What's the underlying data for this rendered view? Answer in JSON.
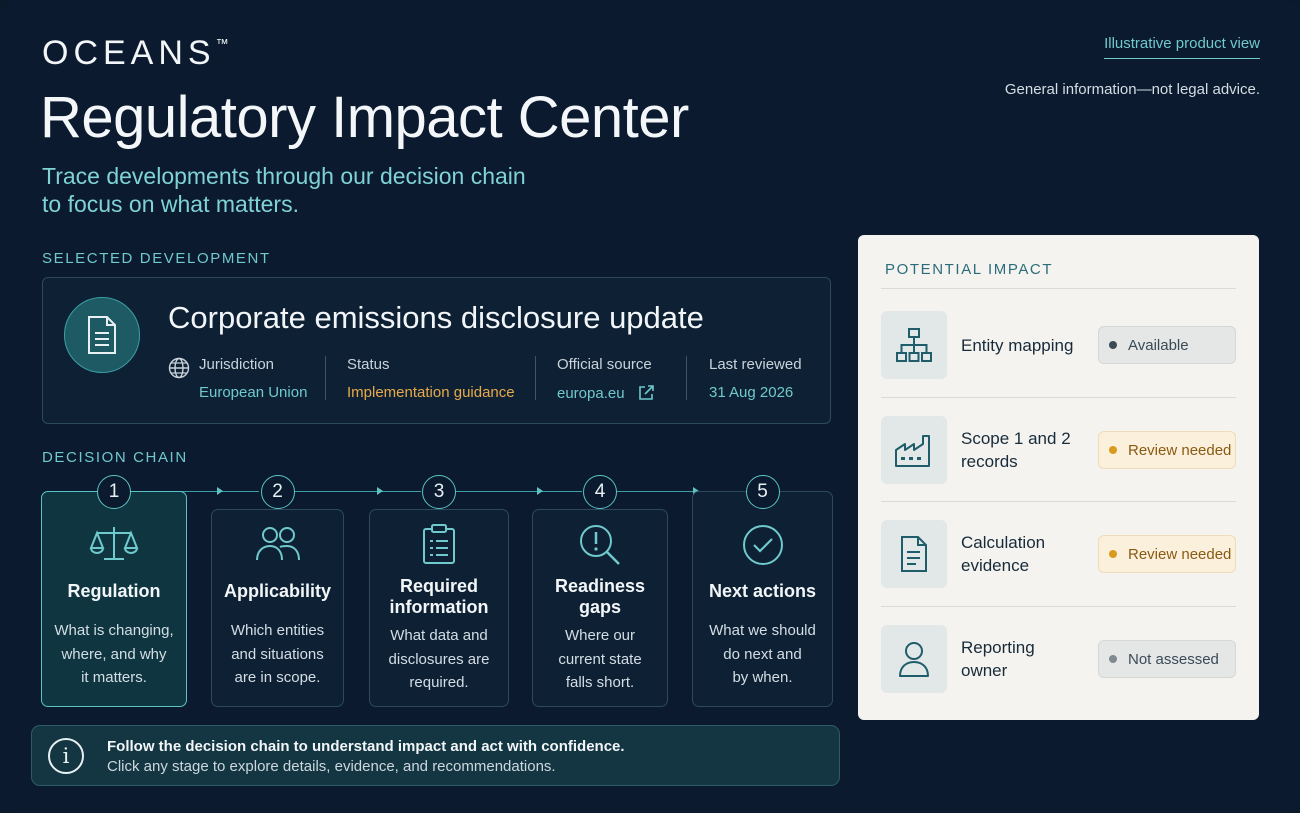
{
  "brand": {
    "name": "OCEANS",
    "mark": "™"
  },
  "header": {
    "title": "Regulatory Impact Center",
    "subtitle_line1": "Trace developments through our decision chain",
    "subtitle_line2": "to focus on what matters.",
    "illustrative_link": "Illustrative product view",
    "disclaimer": "General information—not legal advice."
  },
  "selected": {
    "section_label": "SELECTED DEVELOPMENT",
    "icon": "document-icon",
    "title": "Corporate emissions disclosure update",
    "jurisdiction_label": "Jurisdiction",
    "jurisdiction_value": "European Union",
    "status_label": "Status",
    "status_value": "Implementation guidance",
    "source_label": "Official source",
    "source_value": "europa.eu",
    "reviewed_label": "Last reviewed",
    "reviewed_value": "31 Aug 2026"
  },
  "chain": {
    "section_label": "DECISION CHAIN",
    "stages": [
      {
        "num": "1",
        "icon": "scales-icon",
        "title_line1": "Regulation",
        "title_line2": "",
        "desc_line1": "What is changing,",
        "desc_line2": "where, and why",
        "desc_line3": "it matters."
      },
      {
        "num": "2",
        "icon": "people-icon",
        "title_line1": "Applicability",
        "title_line2": "",
        "desc_line1": "Which entities",
        "desc_line2": "and situations",
        "desc_line3": "are in scope."
      },
      {
        "num": "3",
        "icon": "clipboard-icon",
        "title_line1": "Required",
        "title_line2": "information",
        "desc_line1": "What data and",
        "desc_line2": "disclosures are",
        "desc_line3": "required."
      },
      {
        "num": "4",
        "icon": "magnifier-alert-icon",
        "title_line1": "Readiness",
        "title_line2": "gaps",
        "desc_line1": "Where our",
        "desc_line2": "current state",
        "desc_line3": "falls short."
      },
      {
        "num": "5",
        "icon": "check-circle-icon",
        "title_line1": "Next actions",
        "title_line2": "",
        "desc_line1": "What we should",
        "desc_line2": "do next and",
        "desc_line3": "by when."
      }
    ]
  },
  "info": {
    "icon": "info-icon",
    "line1": "Follow the decision chain to understand impact and act with confidence.",
    "line2": "Click any stage to explore details, evidence, and recommendations."
  },
  "impact": {
    "section_label": "POTENTIAL IMPACT",
    "items": [
      {
        "icon": "hierarchy-icon",
        "name_line1": "Entity mapping",
        "name_line2": "",
        "status": "Available",
        "status_color": "#3b4a55"
      },
      {
        "icon": "factory-icon",
        "name_line1": "Scope 1 and 2",
        "name_line2": "records",
        "status": "Review needed",
        "status_color": "#d99a1e"
      },
      {
        "icon": "document-icon",
        "name_line1": "Calculation",
        "name_line2": "evidence",
        "status": "Review needed",
        "status_color": "#d99a1e"
      },
      {
        "icon": "user-icon",
        "name_line1": "Reporting",
        "name_line2": "owner",
        "status": "Not assessed",
        "status_color": "#7f8a92"
      }
    ]
  },
  "colors": {
    "background": "#0b1a2e",
    "accent": "#6fc9cd",
    "amber": "#e8a94a",
    "panel": "#f5f3ef"
  }
}
